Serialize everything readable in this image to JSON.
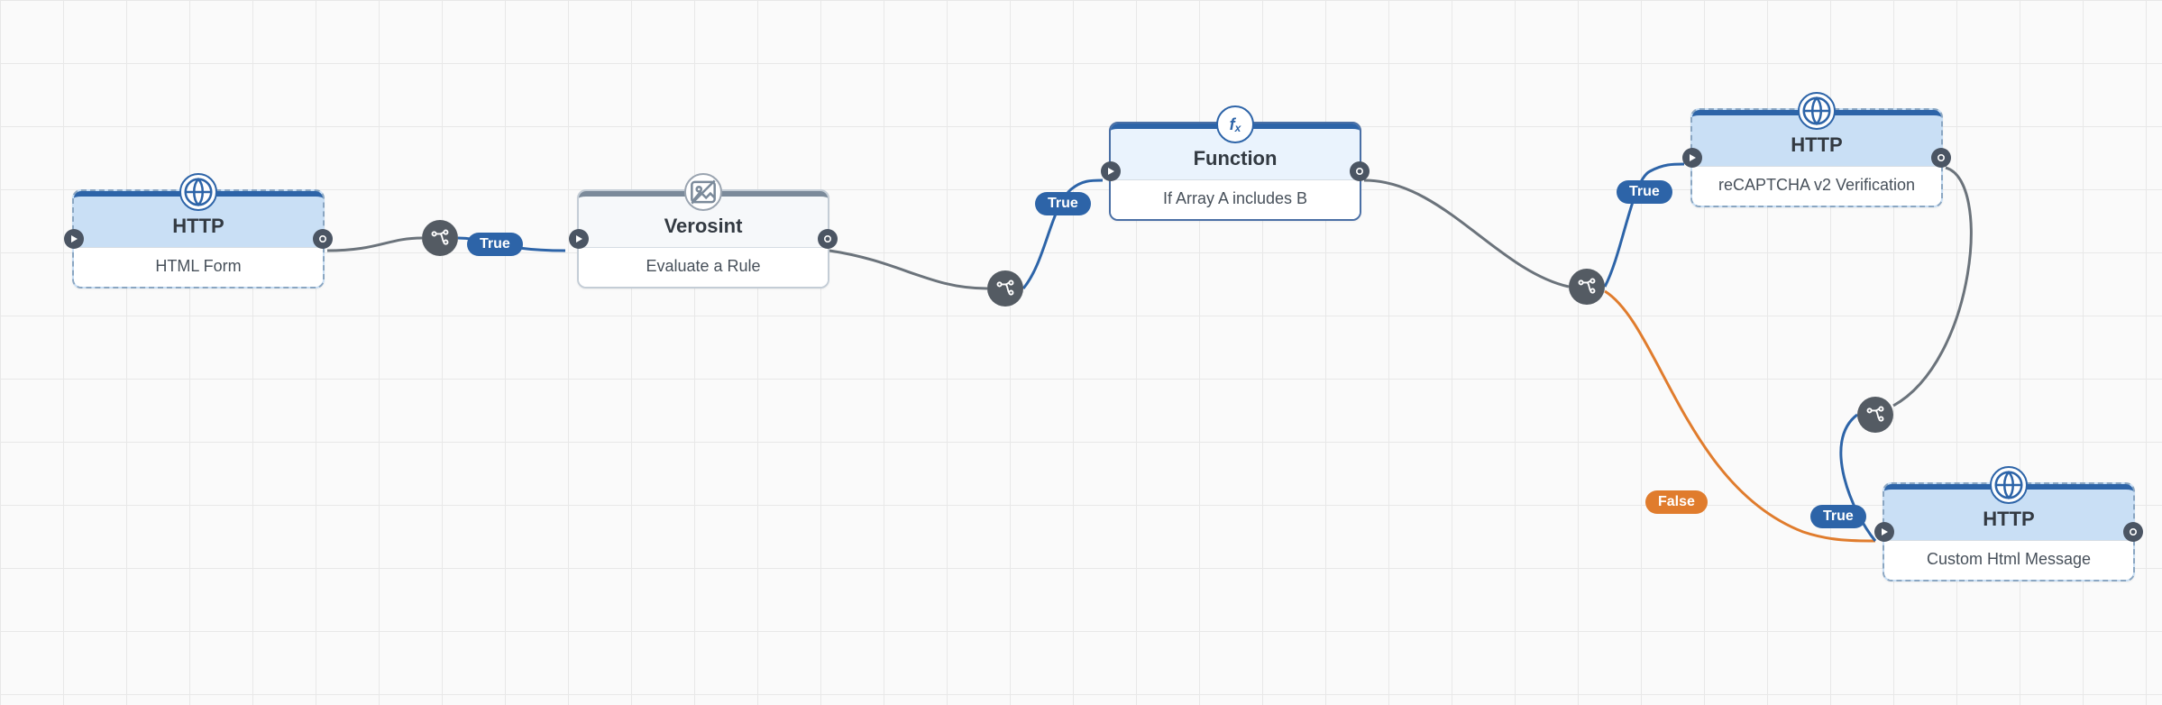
{
  "nodes": {
    "http_form": {
      "title": "HTTP",
      "subtitle": "HTML Form",
      "icon": "globe"
    },
    "verosint": {
      "title": "Verosint",
      "subtitle": "Evaluate a Rule",
      "icon": "image"
    },
    "function": {
      "title": "Function",
      "subtitle": "If Array A includes B",
      "icon": "fx"
    },
    "http_captcha": {
      "title": "HTTP",
      "subtitle": "reCAPTCHA v2 Verification",
      "icon": "globe"
    },
    "http_custom": {
      "title": "HTTP",
      "subtitle": "Custom Html Message",
      "icon": "globe"
    }
  },
  "labels": {
    "true": "True",
    "false": "False"
  },
  "colors": {
    "true_edge": "#2d64a8",
    "false_edge": "#e07c2d",
    "edge": "#6b737b",
    "node_accent": "#2d64a8"
  }
}
